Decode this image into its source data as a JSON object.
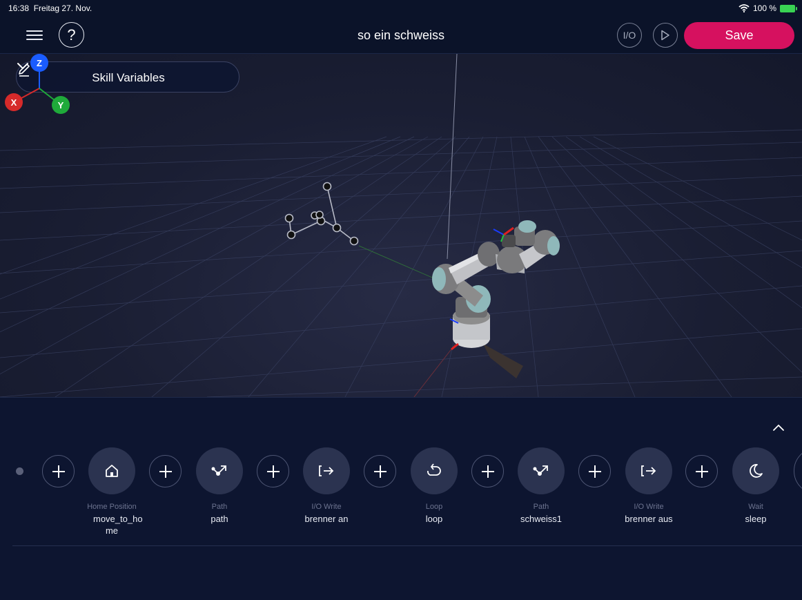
{
  "status_bar": {
    "time": "16:38",
    "date": "Freitag 27. Nov.",
    "battery": "100 %"
  },
  "toolbar": {
    "title": "so ein schweiss",
    "help_label": "?",
    "io_label": "I/O",
    "save_label": "Save"
  },
  "viewport": {
    "dropdown_label": "Skill Variables",
    "gizmo": {
      "z": "Z",
      "x": "X",
      "y": "Y",
      "z_color": "#1a5cff",
      "x_color": "#d62a2a",
      "y_color": "#1faa3a"
    }
  },
  "timeline": {
    "nodes": [
      {
        "type": "Home Position",
        "name": "move_to_ho me",
        "icon": "home-icon"
      },
      {
        "type": "Path",
        "name": "path",
        "icon": "path-icon"
      },
      {
        "type": "I/O Write",
        "name": "brenner an",
        "icon": "io-write-icon"
      },
      {
        "type": "Loop",
        "name": "loop",
        "icon": "loop-icon"
      },
      {
        "type": "Path",
        "name": "schweiss1",
        "icon": "path-icon"
      },
      {
        "type": "I/O Write",
        "name": "brenner aus",
        "icon": "io-write-icon"
      },
      {
        "type": "Wait",
        "name": "sleep",
        "icon": "moon-icon"
      }
    ]
  },
  "colors": {
    "accent": "#d6115f",
    "background": "#0d1530"
  }
}
